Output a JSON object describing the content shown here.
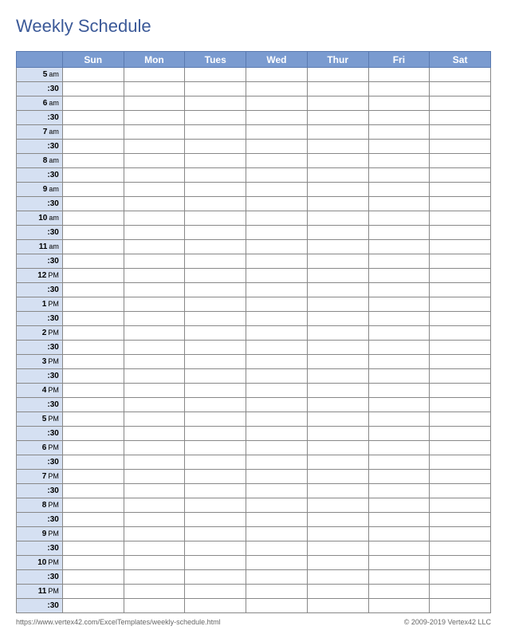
{
  "title": "Weekly Schedule",
  "days": [
    "Sun",
    "Mon",
    "Tues",
    "Wed",
    "Thur",
    "Fri",
    "Sat"
  ],
  "time_rows": [
    {
      "hour": "5",
      "ampm": "am"
    },
    {
      "half": ":30"
    },
    {
      "hour": "6",
      "ampm": "am"
    },
    {
      "half": ":30"
    },
    {
      "hour": "7",
      "ampm": "am"
    },
    {
      "half": ":30"
    },
    {
      "hour": "8",
      "ampm": "am"
    },
    {
      "half": ":30"
    },
    {
      "hour": "9",
      "ampm": "am"
    },
    {
      "half": ":30"
    },
    {
      "hour": "10",
      "ampm": "am"
    },
    {
      "half": ":30"
    },
    {
      "hour": "11",
      "ampm": "am"
    },
    {
      "half": ":30"
    },
    {
      "hour": "12",
      "ampm": "PM"
    },
    {
      "half": ":30"
    },
    {
      "hour": "1",
      "ampm": "PM"
    },
    {
      "half": ":30"
    },
    {
      "hour": "2",
      "ampm": "PM"
    },
    {
      "half": ":30"
    },
    {
      "hour": "3",
      "ampm": "PM"
    },
    {
      "half": ":30"
    },
    {
      "hour": "4",
      "ampm": "PM"
    },
    {
      "half": ":30"
    },
    {
      "hour": "5",
      "ampm": "PM"
    },
    {
      "half": ":30"
    },
    {
      "hour": "6",
      "ampm": "PM"
    },
    {
      "half": ":30"
    },
    {
      "hour": "7",
      "ampm": "PM"
    },
    {
      "half": ":30"
    },
    {
      "hour": "8",
      "ampm": "PM"
    },
    {
      "half": ":30"
    },
    {
      "hour": "9",
      "ampm": "PM"
    },
    {
      "half": ":30"
    },
    {
      "hour": "10",
      "ampm": "PM"
    },
    {
      "half": ":30"
    },
    {
      "hour": "11",
      "ampm": "PM"
    },
    {
      "half": ":30"
    }
  ],
  "footer": {
    "url": "https://www.vertex42.com/ExcelTemplates/weekly-schedule.html",
    "copyright": "© 2009-2019 Vertex42 LLC"
  }
}
